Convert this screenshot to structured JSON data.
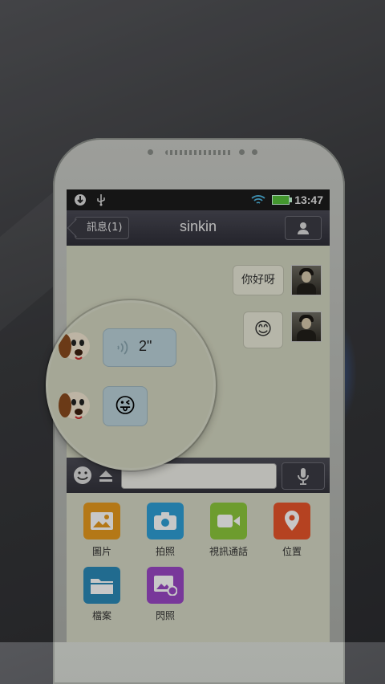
{
  "status_bar": {
    "time": "13:47"
  },
  "header": {
    "back_label": "訊息(1)",
    "title": "sinkin"
  },
  "messages": [
    {
      "side": "out",
      "text": "你好呀"
    },
    {
      "side": "out",
      "text": "😊"
    }
  ],
  "magnified_messages": [
    {
      "side": "in",
      "type": "voice",
      "duration": "2\""
    },
    {
      "side": "in",
      "type": "emoji",
      "text": "😜"
    }
  ],
  "attachments": [
    {
      "label": "圖片",
      "icon": "image-icon",
      "color": "#e79a1e"
    },
    {
      "label": "拍照",
      "icon": "camera-icon",
      "color": "#2f9fd6"
    },
    {
      "label": "視訊通話",
      "icon": "video-icon",
      "color": "#8cc83c"
    },
    {
      "label": "位置",
      "icon": "location-pin-icon",
      "color": "#e8552b"
    },
    {
      "label": "檔案",
      "icon": "folder-icon",
      "color": "#2b89b8"
    },
    {
      "label": "閃照",
      "icon": "flash-photo-icon",
      "color": "#9a47c6"
    }
  ],
  "colors": {
    "titlebar": "#2f2f38",
    "chat_bg": "#d3d6c0",
    "battery": "#56c23c"
  }
}
